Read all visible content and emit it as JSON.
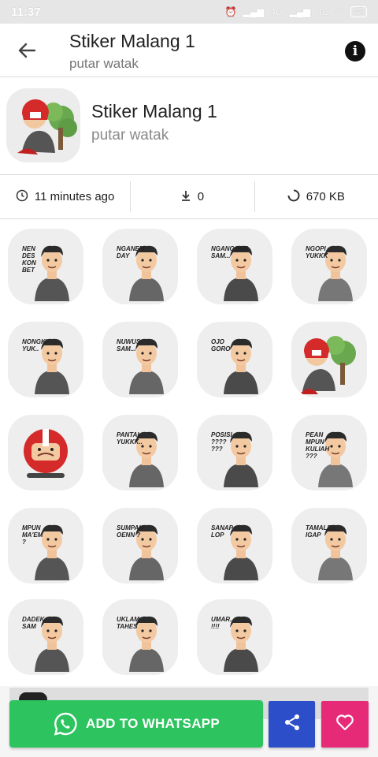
{
  "status_bar": {
    "time": "11:37",
    "network1": "4G",
    "network2": "4G",
    "battery": "42"
  },
  "toolbar": {
    "title": "Stiker Malang 1",
    "subtitle": "putar watak",
    "back_icon": "arrow-left-icon",
    "info_icon": "info-icon",
    "info_glyph": "i"
  },
  "pack": {
    "name": "Stiker Malang 1",
    "author": "putar watak"
  },
  "info": {
    "updated": "11 minutes ago",
    "downloads": "0",
    "size": "670 KB"
  },
  "stickers": [
    {
      "caption": [
        "NEN",
        "DES",
        "KON",
        "BET"
      ]
    },
    {
      "caption": [
        "NGANEM",
        "DAY"
      ]
    },
    {
      "caption": [
        "NGANGGUR",
        "SAM..."
      ]
    },
    {
      "caption": [
        "NGOPI",
        "YUKKK"
      ]
    },
    {
      "caption": [
        "NONGKI",
        "YUK.."
      ]
    },
    {
      "caption": [
        "NUWUS",
        "SAM..."
      ]
    },
    {
      "caption": [
        "OJO",
        "GORO"
      ]
    },
    {
      "caption": []
    },
    {
      "caption": []
    },
    {
      "caption": [
        "PANTAI",
        "YUKKK.."
      ]
    },
    {
      "caption": [
        "POSISI",
        "????",
        "???"
      ]
    },
    {
      "caption": [
        "PEAN",
        "MPUN",
        "KULIAH",
        "???"
      ]
    },
    {
      "caption": [
        "MPUN",
        "MA'EM",
        "?"
      ]
    },
    {
      "caption": [
        "SUMPAH",
        "OENN ?"
      ]
    },
    {
      "caption": [
        "SANAP",
        "LOP"
      ]
    },
    {
      "caption": [
        "TAMALES",
        "IGAP"
      ]
    },
    {
      "caption": [
        "DADEK",
        "SAM"
      ]
    },
    {
      "caption": [
        "UKLAM",
        "TAHES"
      ]
    },
    {
      "caption": [
        "UMAR...",
        "!!!!"
      ]
    }
  ],
  "actions": {
    "whatsapp_label": "ADD TO WHATSAPP",
    "share_icon": "share-icon",
    "favorite_icon": "heart-icon"
  },
  "colors": {
    "whatsapp": "#2dc45f",
    "share": "#2c4fc9",
    "favorite": "#e62a78"
  }
}
